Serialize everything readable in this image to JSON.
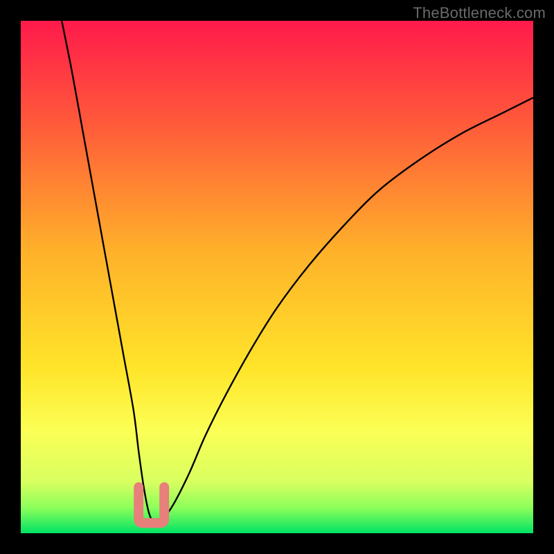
{
  "watermark": {
    "text": "TheBottleneck.com"
  },
  "chart_data": {
    "type": "line",
    "title": "",
    "xlabel": "",
    "ylabel": "",
    "xlim": [
      0,
      100
    ],
    "ylim": [
      0,
      100
    ],
    "grid": false,
    "legend": false,
    "background_gradient": {
      "stops": [
        {
          "pct": 0,
          "color": "#ff1a4b"
        },
        {
          "pct": 20,
          "color": "#ff5a3a"
        },
        {
          "pct": 45,
          "color": "#ffb12a"
        },
        {
          "pct": 68,
          "color": "#ffe52a"
        },
        {
          "pct": 80,
          "color": "#fbff55"
        },
        {
          "pct": 90,
          "color": "#d8ff60"
        },
        {
          "pct": 95,
          "color": "#8dff5a"
        },
        {
          "pct": 100,
          "color": "#00e364"
        }
      ]
    },
    "series": [
      {
        "name": "bottleneck-curve",
        "color": "#000000",
        "x": [
          8,
          10,
          12,
          14,
          16,
          18,
          20,
          22,
          23,
          24,
          25,
          26,
          27,
          28,
          30,
          33,
          36,
          40,
          45,
          50,
          56,
          63,
          70,
          78,
          86,
          94,
          100
        ],
        "y": [
          100,
          90,
          79,
          68,
          57,
          46,
          35,
          24,
          16,
          9,
          4,
          2,
          2,
          3,
          6,
          12,
          19,
          27,
          36,
          44,
          52,
          60,
          67,
          73,
          78,
          82,
          85
        ]
      }
    ],
    "annotations": [
      {
        "name": "min-marker",
        "shape": "rounded-u",
        "color": "#e77f7a",
        "x_range": [
          23,
          28
        ],
        "y_range": [
          2,
          9
        ]
      }
    ],
    "minimum": {
      "x": 25.5,
      "y": 2
    }
  }
}
